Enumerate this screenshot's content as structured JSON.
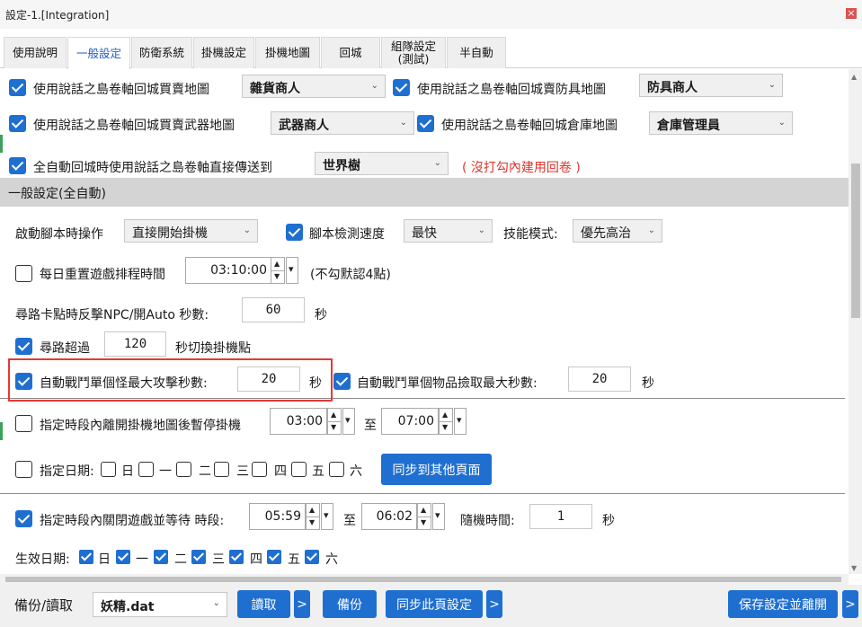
{
  "window": {
    "title": "設定-1.[Integration]",
    "close_glyph": "×"
  },
  "tabs": [
    {
      "label": "使用說明"
    },
    {
      "label": "一般設定"
    },
    {
      "label": "防衛系統"
    },
    {
      "label": "掛機設定"
    },
    {
      "label": "掛機地圖"
    },
    {
      "label": "回城"
    },
    {
      "label": "組隊設定\n(測試)"
    },
    {
      "label": "半自動"
    }
  ],
  "shop": {
    "item1_label": "使用說話之島卷軸回城買賣地圖",
    "item1_value": "雜貨商人",
    "item2_label": "使用說話之島卷軸回城賣防具地圖",
    "item2_value": "防具商人",
    "item3_label": "使用說話之島卷軸回城買賣武器地圖",
    "item3_value": "武器商人",
    "item4_label": "使用說話之島卷軸回城倉庫地圖",
    "item4_value": "倉庫管理員",
    "item5_label": "全自動回城時使用說話之島卷軸直接傳送到",
    "item5_value": "世界樹",
    "item5_note": "( 沒打勾內建用回卷 )"
  },
  "section_title": "一般設定(全自動)",
  "startup": {
    "label": "啟動腳本時操作",
    "value": "直接開始掛機",
    "speed_label": "腳本檢測速度",
    "speed_value": "最快",
    "skill_label": "技能模式:",
    "skill_value": "優先高治"
  },
  "daily_reset": {
    "label": "每日重置遊戲排程時間",
    "time": "03:10:00",
    "note": "(不勾默認4點)"
  },
  "stuck": {
    "label": "尋路卡點時反擊NPC/開Auto 秒數:",
    "value": "60",
    "unit": "秒"
  },
  "pathfind": {
    "label": "尋路超過",
    "value": "120",
    "unit": "秒切換掛機點"
  },
  "battle": {
    "monster_label": "自動戰鬥單個怪最大攻擊秒數:",
    "monster_value": "20",
    "monster_unit": "秒",
    "item_label": "自動戰鬥單個物品撿取最大秒數:",
    "item_value": "20",
    "item_unit": "秒"
  },
  "pause": {
    "label": "指定時段內離開掛機地圖後暫停掛機",
    "start": "03:00",
    "to": "至",
    "end": "07:00"
  },
  "dates": {
    "label": "指定日期:",
    "days": [
      "日",
      "一",
      "二",
      "三",
      "四",
      "五",
      "六"
    ],
    "sync_button": "同步到其他頁面"
  },
  "close_game": {
    "label": "指定時段內關閉遊戲並等待 時段:",
    "start": "05:59",
    "to": "至",
    "end": "06:02",
    "random_label": "隨機時間:",
    "random_value": "1",
    "random_unit": "秒"
  },
  "effective": {
    "label": "生效日期:",
    "days": [
      "日",
      "一",
      "二",
      "三",
      "四",
      "五",
      "六"
    ]
  },
  "bottom": {
    "backup_label": "備份/讀取",
    "file_value": "妖精.dat",
    "read_button": "讀取",
    "more1": ">",
    "backup_button": "備份",
    "sync_page_button": "同步此頁設定",
    "more2": ">",
    "save_button": "保存設定並離開",
    "more3": ">"
  },
  "colors": {
    "accent": "#1f6fd1",
    "highlight": "#e53935",
    "note": "#e0342c",
    "section": "#d4d4d4"
  }
}
